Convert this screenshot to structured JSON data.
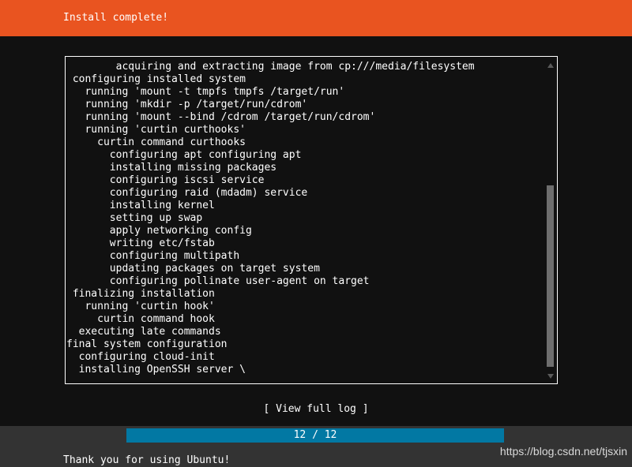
{
  "header": {
    "title": "Install complete!",
    "background_color": "#e95420",
    "text_color": "#ffffff"
  },
  "log": {
    "lines": [
      "        acquiring and extracting image from cp:///media/filesystem",
      " configuring installed system",
      "   running 'mount -t tmpfs tmpfs /target/run'",
      "   running 'mkdir -p /target/run/cdrom'",
      "   running 'mount --bind /cdrom /target/run/cdrom'",
      "   running 'curtin curthooks'",
      "     curtin command curthooks",
      "       configuring apt configuring apt",
      "       installing missing packages",
      "       configuring iscsi service",
      "       configuring raid (mdadm) service",
      "       installing kernel",
      "       setting up swap",
      "       apply networking config",
      "       writing etc/fstab",
      "       configuring multipath",
      "       updating packages on target system",
      "       configuring pollinate user-agent on target",
      " finalizing installation",
      "   running 'curtin hook'",
      "     curtin command hook",
      "  executing late commands",
      "final system configuration",
      "  configuring cloud-init",
      "  installing OpenSSH server \\"
    ],
    "scrollbar": {
      "up_arrow": "scroll-up-arrow",
      "down_arrow": "scroll-down-arrow",
      "thumb_color": "#6e6e6e"
    },
    "border_color": "#ffffff",
    "background_color": "#111111"
  },
  "actions": {
    "view_full_log": "[ View full log ]"
  },
  "progress": {
    "label": "12 / 12",
    "current": 12,
    "total": 12,
    "percent": 100,
    "fill_color": "#0278a3"
  },
  "footer": {
    "message": "Thank you for using Ubuntu!",
    "background_color": "#333333"
  },
  "watermark": {
    "text": "https://blog.csdn.net/tjsxin"
  }
}
